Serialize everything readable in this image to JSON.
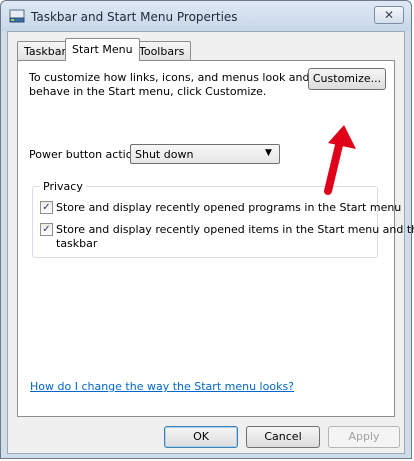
{
  "window": {
    "title": "Taskbar and Start Menu Properties",
    "close_glyph": "✕"
  },
  "tabs": [
    {
      "label": "Taskbar",
      "active": false
    },
    {
      "label": "Start Menu",
      "active": true
    },
    {
      "label": "Toolbars",
      "active": false
    }
  ],
  "start_menu": {
    "description_line1": "To customize how links, icons, and menus look and",
    "description_line2": "behave in the Start menu, click Customize.",
    "customize_label": "Customize...",
    "power_label": "Power button action:",
    "power_value": "Shut down"
  },
  "privacy": {
    "title": "Privacy",
    "option1": {
      "label": "Store and display recently opened programs in the Start menu",
      "checked": true
    },
    "option2_line1": "Store and display recently opened items in the Start menu and the",
    "option2_line2": "taskbar",
    "option2_checked": true,
    "check_glyph": "✓"
  },
  "help_link": "How do I change the way the Start menu looks?",
  "footer": {
    "ok_label": "OK",
    "cancel_label": "Cancel",
    "apply_label": "Apply"
  },
  "colors": {
    "annotation_arrow": "#e0001a",
    "link": "#0066cc"
  }
}
